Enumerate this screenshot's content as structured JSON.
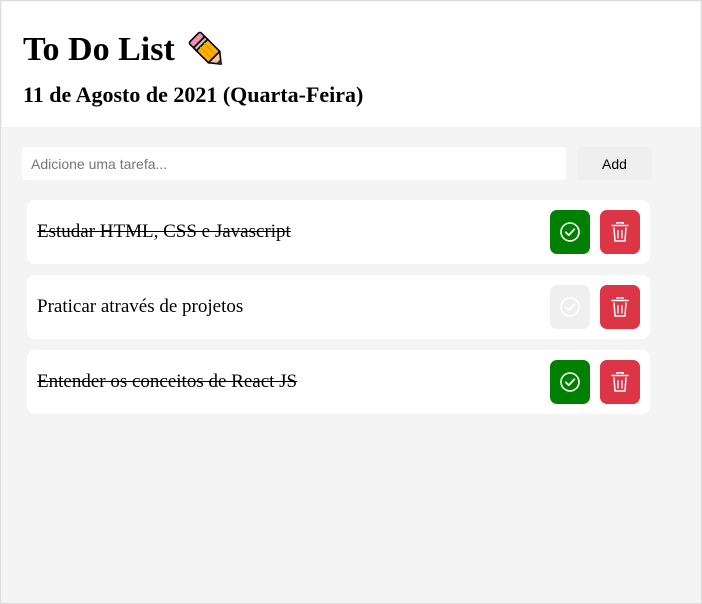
{
  "header": {
    "title": "To Do List",
    "date": "11 de Agosto de 2021 (Quarta-Feira)"
  },
  "form": {
    "placeholder": "Adicione uma tarefa...",
    "value": "",
    "add_label": "Add"
  },
  "tasks": [
    {
      "text": "Estudar HTML, CSS e Javascript",
      "completed": true
    },
    {
      "text": "Praticar através de projetos",
      "completed": false
    },
    {
      "text": "Entender os conceitos de React JS",
      "completed": true
    }
  ],
  "icons": {
    "title": "pencil-icon",
    "check": "check-circle-icon",
    "delete": "trash-icon"
  },
  "colors": {
    "completed_button": "#008000",
    "pending_button": "#efefef",
    "delete_button": "#dc3545"
  }
}
